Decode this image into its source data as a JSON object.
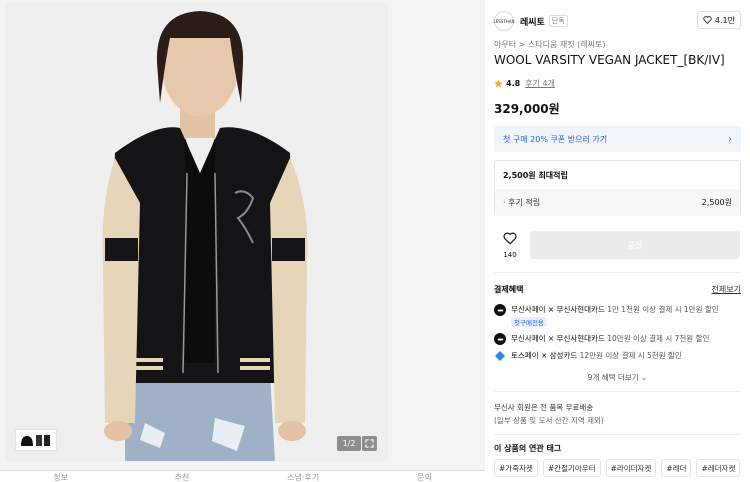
{
  "gallery": {
    "counter": "1/2",
    "bottom_tabs": [
      "정보",
      "추천",
      "스냅·후기",
      "문의"
    ]
  },
  "brand": {
    "logo_text": "LESSTHAN",
    "name": "레씨토",
    "badge": "단독",
    "likes": "4.1만"
  },
  "product": {
    "breadcrumb": "아우터 > 스타디움 재킷 (레씨토)",
    "title": "WOOL VARSITY VEGAN JACKET_[BK/IV]",
    "rating": "4.8",
    "reviews": "후기 4개",
    "price": "329,000원"
  },
  "coupon": {
    "label": "첫 구매 20% 쿠폰 받으러 가기"
  },
  "points": {
    "title": "2,500원 최대적립",
    "row_label": "· 후기 적립",
    "row_value": "2,500원"
  },
  "actions": {
    "like_count": "140",
    "buy_label": "품절"
  },
  "payment": {
    "title": "결제혜택",
    "view_all": "전체보기",
    "items": [
      {
        "name": "무신사페이 × 무신사현대카드",
        "desc": "1만 1천원 이상 결제 시 1만원 할인",
        "tag": "첫구매전용"
      },
      {
        "name": "무신사페이 × 무신사현대카드",
        "desc": "10만원 이상 결제 시 7천원 할인"
      },
      {
        "name": "토스페이 × 삼성카드",
        "desc": "12만원 이상 결제 시 5천원 할인"
      }
    ],
    "more": "9개 혜택 더보기"
  },
  "shipping": {
    "line1": "무신사 회원은 전 품목 무료배송",
    "line2": "(일부 상품 및 도서 산간 지역 제외)"
  },
  "tags": {
    "title": "이 상품의 연관 태그",
    "items": [
      "#가죽자켓",
      "#간절기아우터",
      "#라이더자켓",
      "#레더",
      "#레더자켓"
    ]
  },
  "colors": {
    "accent": "#2b62d9",
    "star": "#f5a623",
    "disabled_button": "#ececec"
  }
}
